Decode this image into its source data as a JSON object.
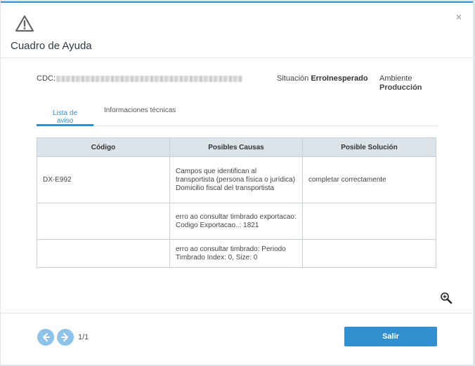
{
  "dialog": {
    "title": "Cuadro de Ayuda",
    "close_label": "×"
  },
  "info": {
    "cdc_label": "CDC:",
    "situacion_label": "Situación ",
    "situacion_value": "ErroInesperado",
    "ambiente_label": "Ambiente",
    "ambiente_value": "Producción"
  },
  "tabs": [
    {
      "label": "Lista de aviso",
      "active": true
    },
    {
      "label": "Informaciones técnicas",
      "active": false
    }
  ],
  "table": {
    "headers": [
      "Código",
      "Posibles Causas",
      "Posible Solución"
    ],
    "rows": [
      [
        "DX-E992",
        "Campos que identifican al transportista (persona física o jurídica) Domicilio fiscal del transportista",
        "completar correctamente"
      ],
      [
        "",
        "erro ao consultar timbrado exportacao: Codigo Exportacao..: 1821",
        ""
      ],
      [
        "",
        "erro ao consultar timbrado: Periodo Timbrado Index: 0, Size: 0",
        ""
      ]
    ]
  },
  "pagination": {
    "prev_icon": "arrow-left-icon",
    "next_icon": "arrow-right-icon",
    "page_text": "1/1"
  },
  "buttons": {
    "salir_label": "Salir"
  },
  "colors": {
    "accent": "#2f8fcf",
    "header_bg": "#dce4ea",
    "pager_button": "#8ec3e9"
  }
}
